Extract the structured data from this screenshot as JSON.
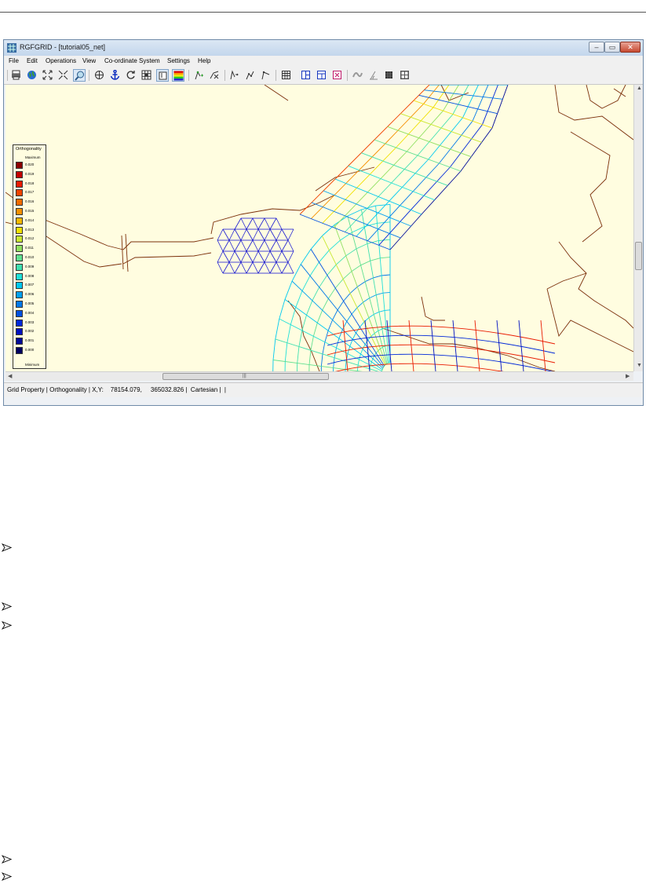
{
  "window": {
    "title": "RGFGRID - [tutorial05_net]",
    "controls": {
      "minimize": "–",
      "maximize": "▭",
      "close": "✕"
    }
  },
  "menu": [
    "File",
    "Edit",
    "Operations",
    "View",
    "Co-ordinate System",
    "Settings",
    "Help"
  ],
  "toolbar": {
    "buttons": [
      "print-icon",
      "globe-icon",
      "zoom-extent-icon",
      "zoom-box-icon",
      "zoom-icon",
      "crosshair-icon",
      "anchor-icon",
      "refresh-icon",
      "grid-cells-icon",
      "property-view-icon",
      "color-scale-icon",
      "spline-add-icon",
      "spline-delete-icon",
      "spline-move-icon",
      "spline-insert-icon",
      "spline-point-icon",
      "grid-table-icon",
      "grid-split-icon",
      "grid-refine-icon",
      "grid-coarsen-icon",
      "smooth-icon",
      "ortho-icon",
      "fill-icon",
      "layout-icon"
    ],
    "active": [
      "zoom-icon",
      "property-view-icon",
      "color-scale-icon"
    ]
  },
  "legend": {
    "title": "Orthogonality",
    "max_label": "Maximum",
    "min_label": "Minimum",
    "items": [
      {
        "label": "0.020",
        "color": "#8b0000"
      },
      {
        "label": "0.019",
        "color": "#c40000"
      },
      {
        "label": "0.018",
        "color": "#e81a00"
      },
      {
        "label": "0.017",
        "color": "#f04400"
      },
      {
        "label": "0.016",
        "color": "#f06a00"
      },
      {
        "label": "0.015",
        "color": "#f59000"
      },
      {
        "label": "0.014",
        "color": "#f5b800"
      },
      {
        "label": "0.013",
        "color": "#f0e000"
      },
      {
        "label": "0.012",
        "color": "#c8e830"
      },
      {
        "label": "0.011",
        "color": "#90e060"
      },
      {
        "label": "0.010",
        "color": "#60e090"
      },
      {
        "label": "0.009",
        "color": "#40e0b0"
      },
      {
        "label": "0.008",
        "color": "#20e0d8"
      },
      {
        "label": "0.007",
        "color": "#00c8f0"
      },
      {
        "label": "0.006",
        "color": "#00a0f0"
      },
      {
        "label": "0.005",
        "color": "#0078e8"
      },
      {
        "label": "0.004",
        "color": "#0050e0"
      },
      {
        "label": "0.003",
        "color": "#0028d8"
      },
      {
        "label": "0.002",
        "color": "#0010c0"
      },
      {
        "label": "0.001",
        "color": "#000a98"
      },
      {
        "label": "0.000",
        "color": "#000060"
      }
    ]
  },
  "status": {
    "text": "Grid Property | Orthogonality | X,Y:    78154.079,     365032.826 |  Cartesian |  |"
  },
  "colors": {
    "land_boundary": "#7a2e0a",
    "map_background": "#fffde0",
    "net_blue": "#1a1ad0"
  }
}
